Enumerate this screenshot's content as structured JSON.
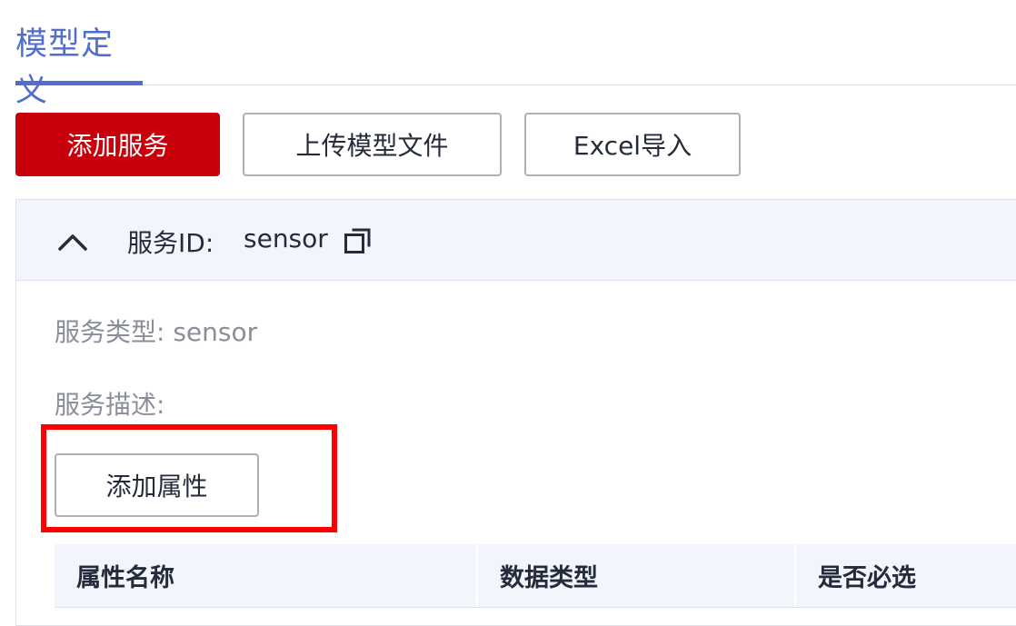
{
  "tabs": {
    "active_label": "模型定义"
  },
  "toolbar": {
    "add_service_label": "添加服务",
    "upload_model_label": "上传模型文件",
    "excel_import_label": "Excel导入"
  },
  "service": {
    "id_label": "服务ID:",
    "id_value": "sensor",
    "type_text": "服务类型: sensor",
    "description_text": "服务描述:",
    "add_property_label": "添加属性"
  },
  "property_table": {
    "columns": [
      "属性名称",
      "数据类型",
      "是否必选"
    ]
  },
  "colors": {
    "accent": "#526ecc",
    "primary_button": "#c7000b",
    "highlight": "#ff0000"
  },
  "icons": {
    "collapse": "chevron-up-icon",
    "copy": "copy-icon"
  }
}
